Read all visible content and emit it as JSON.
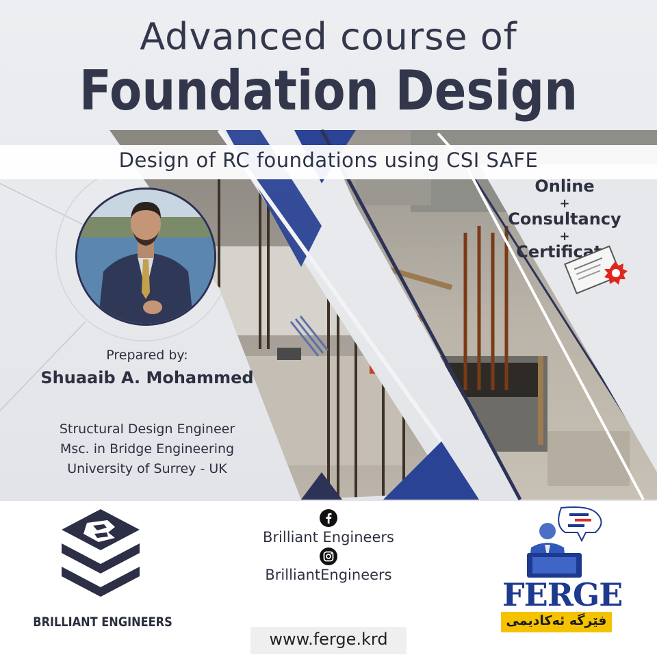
{
  "poster": {
    "title_line1": "Advanced course of",
    "title_line2": "Foundation Design",
    "subtitle": "Design of RC foundations using CSI SAFE",
    "prepared_by_label": "Prepared by:",
    "author_name": "Shuaaib A. Mohammed",
    "credentials": [
      "Structural Design Engineer",
      "Msc. in Bridge Engineering",
      "University of Surrey - UK"
    ],
    "offers": [
      "Online",
      "+",
      "Consultancy",
      "+",
      "Certificate"
    ]
  },
  "footer": {
    "brand_name": "BRILLIANT ENGINEERS",
    "facebook_label": "Brilliant Engineers",
    "instagram_label": "BrilliantEngineers",
    "website": "www.ferge.krd",
    "partner_logo_text": "FERGE",
    "partner_logo_subtitle": "فێرگە ئەکادیمی"
  },
  "colors": {
    "navy": "#2c3357",
    "blue": "#2a4394",
    "dark_text": "#33374b",
    "ferge_blue": "#1d3a8f",
    "ferge_yellow": "#f5c200",
    "seal_red": "#e0271f"
  },
  "icons": [
    "facebook-icon",
    "instagram-icon",
    "certificate-icon",
    "brilliant-engineers-logo",
    "ferge-logo"
  ]
}
